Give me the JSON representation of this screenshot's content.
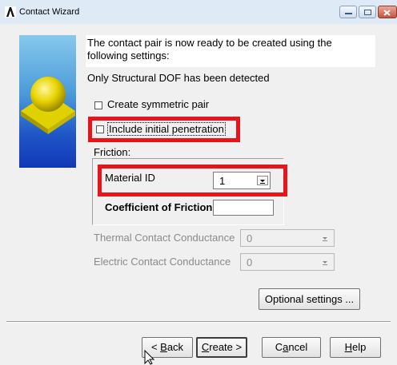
{
  "window": {
    "title": "Contact Wizard",
    "accent": "#dfeaf7"
  },
  "intro": {
    "text": "The contact pair is now ready to be created using the following settings:",
    "dof_note": "Only Structural DOF has been detected"
  },
  "options": {
    "symmetric_label": "Create symmetric pair",
    "symmetric_checked": false,
    "penetration_label": "Include initial penetration",
    "penetration_checked": false
  },
  "friction": {
    "group_label": "Friction:",
    "material_label": "Material ID",
    "material_value": "1",
    "coefficient_label": "Coefficient of Friction",
    "coefficient_value": ""
  },
  "conductance": {
    "thermal_label": "Thermal Contact Conductance",
    "thermal_value": "0",
    "electric_label": "Electric Contact Conductance",
    "electric_value": "0"
  },
  "buttons": {
    "optional": "Optional settings ...",
    "back_mnemonic": "B",
    "back_rest": "ack",
    "back_prefix": "< ",
    "create_mnemonic": "C",
    "create_rest": "reate >",
    "cancel_pre": "C",
    "cancel_mnemonic": "a",
    "cancel_rest": "ncel",
    "help_mnemonic": "H",
    "help_rest": "elp"
  },
  "highlight_color": "#e8141c"
}
